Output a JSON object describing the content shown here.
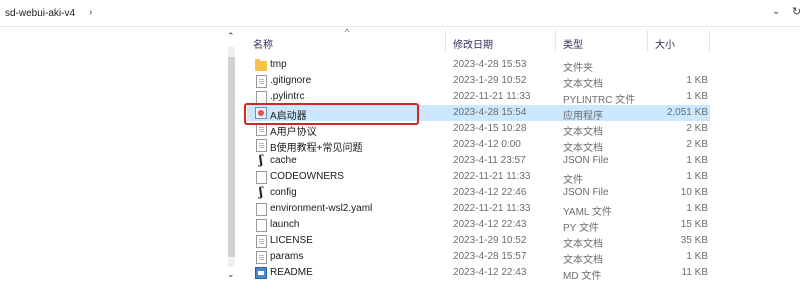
{
  "addressbar": {
    "crumb": "sd-webui-aki-v4",
    "chevron": "›",
    "dropdown": "⌄",
    "refresh": "↻"
  },
  "header": {
    "name": "名称",
    "sort_indicator": "^",
    "date": "修改日期",
    "type": "类型",
    "size": "大小"
  },
  "scrollbar": {
    "up": "⌃",
    "down": "⌄"
  },
  "files": [
    {
      "name": "tmp",
      "date": "2023-4-28 15:53",
      "type": "文件夹",
      "size": "",
      "icon": "folder-icon"
    },
    {
      "name": ".gitignore",
      "date": "2023-1-29 10:52",
      "type": "文本文档",
      "size": "1 KB",
      "icon": "text-file-icon"
    },
    {
      "name": ".pylintrc",
      "date": "2022-11-21 11:33",
      "type": "PYLINTRC 文件",
      "size": "1 KB",
      "icon": "file-icon"
    },
    {
      "name": "A启动器",
      "date": "2023-4-28 15:54",
      "type": "应用程序",
      "size": "2,051 KB",
      "icon": "app-icon"
    },
    {
      "name": "A用户协议",
      "date": "2023-4-15 10:28",
      "type": "文本文档",
      "size": "2 KB",
      "icon": "text-file-icon"
    },
    {
      "name": "B使用教程+常见问题",
      "date": "2023-4-12 0:00",
      "type": "文本文档",
      "size": "2 KB",
      "icon": "text-file-icon"
    },
    {
      "name": "cache",
      "date": "2023-4-11 23:57",
      "type": "JSON File",
      "size": "1 KB",
      "icon": "json-icon"
    },
    {
      "name": "CODEOWNERS",
      "date": "2022-11-21 11:33",
      "type": "文件",
      "size": "1 KB",
      "icon": "file-icon"
    },
    {
      "name": "config",
      "date": "2023-4-12 22:46",
      "type": "JSON File",
      "size": "10 KB",
      "icon": "json-icon"
    },
    {
      "name": "environment-wsl2.yaml",
      "date": "2022-11-21 11:33",
      "type": "YAML 文件",
      "size": "1 KB",
      "icon": "file-icon"
    },
    {
      "name": "launch",
      "date": "2023-4-12 22:43",
      "type": "PY 文件",
      "size": "15 KB",
      "icon": "file-icon"
    },
    {
      "name": "LICENSE",
      "date": "2023-1-29 10:52",
      "type": "文本文档",
      "size": "35 KB",
      "icon": "text-file-icon"
    },
    {
      "name": "params",
      "date": "2023-4-28 15:57",
      "type": "文本文档",
      "size": "1 KB",
      "icon": "text-file-icon"
    },
    {
      "name": "README",
      "date": "2023-4-12 22:43",
      "type": "MD 文件",
      "size": "11 KB",
      "icon": "md-icon"
    }
  ],
  "selected_index": 3,
  "colors": {
    "selection": "#cce8ff",
    "highlight_box": "#d0281f",
    "folder": "#f5c445"
  }
}
